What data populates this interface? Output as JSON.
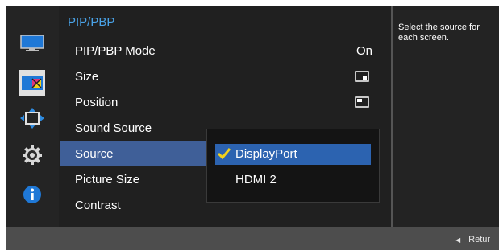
{
  "menu": {
    "title": "PIP/PBP",
    "items": [
      {
        "label": "PIP/PBP Mode",
        "value": "On"
      },
      {
        "label": "Size"
      },
      {
        "label": "Position"
      },
      {
        "label": "Sound Source"
      },
      {
        "label": "Source"
      },
      {
        "label": "Picture Size"
      },
      {
        "label": "Contrast"
      }
    ]
  },
  "dropdown": {
    "options": [
      {
        "label": "DisplayPort",
        "selected": true
      },
      {
        "label": "HDMI 2",
        "selected": false
      }
    ]
  },
  "help": {
    "text": "Select the source for each screen."
  },
  "footer": {
    "return_label": "Retur"
  },
  "sidebar": {
    "icons": [
      "picture-icon",
      "color-icon",
      "size-position-icon",
      "settings-icon",
      "info-icon"
    ]
  },
  "colors": {
    "title": "#4aa3e8",
    "selected_row": "#3f5f98",
    "selected_option": "#2c63b0",
    "check": "#f2d21b"
  }
}
